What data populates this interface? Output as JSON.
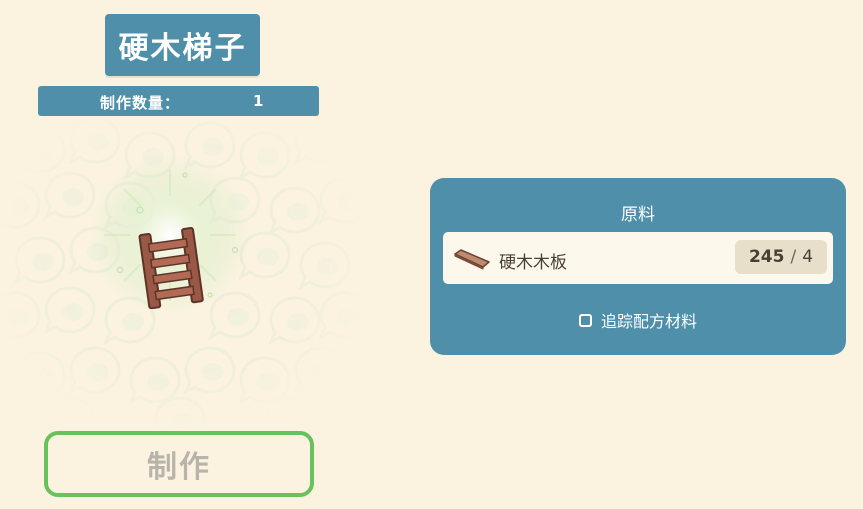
{
  "recipe": {
    "title": "硬木梯子",
    "quantity_label": "制作数量：",
    "quantity_value": "1",
    "item_icon": "wooden-ladder-icon",
    "craft_button_label": "制作"
  },
  "materials": {
    "header": "原料",
    "items": [
      {
        "name": "硬木木板",
        "icon": "hardwood-plank-icon",
        "have": "245",
        "separator": "/",
        "need": "4"
      }
    ],
    "track_label": "追踪配方材料",
    "track_checked": false
  },
  "colors": {
    "background": "#fbf3e0",
    "panel_blue": "#4f8fa9",
    "craft_border_green": "#66c25c",
    "disabled_text": "#b9b4ab",
    "row_background": "#fdf8ec",
    "count_pill": "#e8dfca"
  }
}
